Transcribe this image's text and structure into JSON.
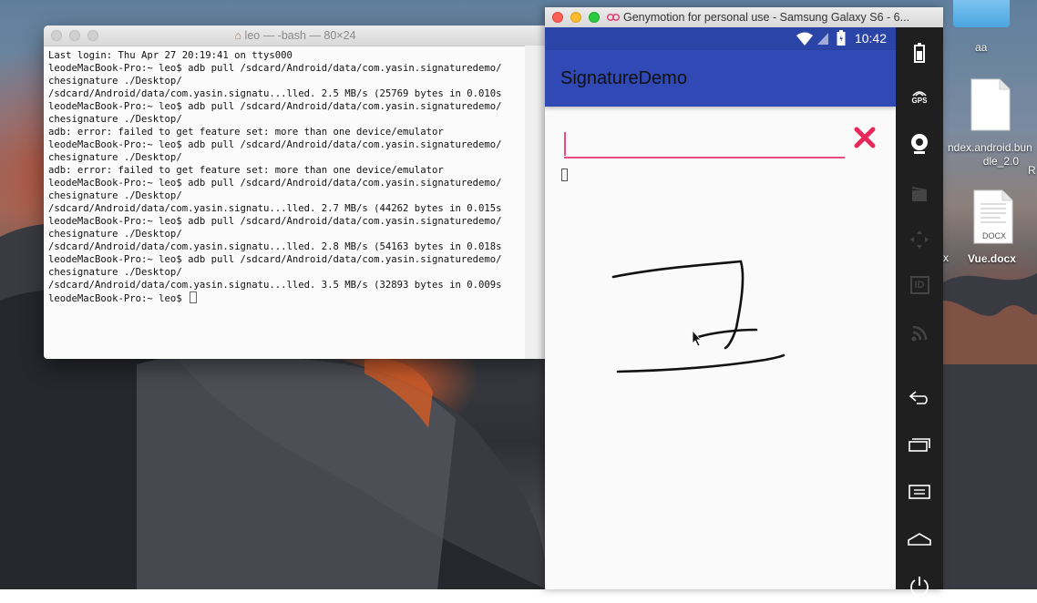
{
  "desktop": {
    "icons": [
      {
        "label": "aa"
      },
      {
        "label": "ndex.android.bun\ndle_2.0"
      },
      {
        "label": "Vue.docx",
        "badge": "DOCX"
      },
      {
        "label": "R"
      },
      {
        "label": "x"
      }
    ]
  },
  "terminal": {
    "title": "leo — -bash — 80×24",
    "title_icon": "home-icon",
    "lines": [
      "Last login: Thu Apr 27 20:19:41 on ttys000",
      "leodeMacBook-Pro:~ leo$ adb pull /sdcard/Android/data/com.yasin.signaturedemo/",
      "chesignature ./Desktop/",
      "/sdcard/Android/data/com.yasin.signatu...lled. 2.5 MB/s (25769 bytes in 0.010s",
      "leodeMacBook-Pro:~ leo$ adb pull /sdcard/Android/data/com.yasin.signaturedemo/",
      "chesignature ./Desktop/",
      "adb: error: failed to get feature set: more than one device/emulator",
      "leodeMacBook-Pro:~ leo$ adb pull /sdcard/Android/data/com.yasin.signaturedemo/",
      "chesignature ./Desktop/",
      "adb: error: failed to get feature set: more than one device/emulator",
      "leodeMacBook-Pro:~ leo$ adb pull /sdcard/Android/data/com.yasin.signaturedemo/",
      "chesignature ./Desktop/",
      "/sdcard/Android/data/com.yasin.signatu...lled. 2.7 MB/s (44262 bytes in 0.015s",
      "leodeMacBook-Pro:~ leo$ adb pull /sdcard/Android/data/com.yasin.signaturedemo/",
      "chesignature ./Desktop/",
      "/sdcard/Android/data/com.yasin.signatu...lled. 2.8 MB/s (54163 bytes in 0.018s",
      "leodeMacBook-Pro:~ leo$ adb pull /sdcard/Android/data/com.yasin.signaturedemo/",
      "chesignature ./Desktop/",
      "/sdcard/Android/data/com.yasin.signatu...lled. 3.5 MB/s (32893 bytes in 0.009s",
      "leodeMacBook-Pro:~ leo$ "
    ]
  },
  "genymotion": {
    "title": "Genymotion for personal use - Samsung Galaxy S6 - 6...",
    "status_time": "10:42",
    "app_title": "SignatureDemo",
    "input_value": "",
    "colors": {
      "primary": "#3049b4",
      "primary_dark": "#2b44a8",
      "accent": "#e84b7d",
      "clear": "#e8275a"
    },
    "sidebar": [
      {
        "name": "battery-icon"
      },
      {
        "name": "gps-icon",
        "label": "GPS"
      },
      {
        "name": "webcam-icon"
      },
      {
        "name": "media-icon"
      },
      {
        "name": "dpad-icon"
      },
      {
        "name": "identifiers-icon",
        "label": "ID"
      },
      {
        "name": "network-icon"
      },
      {
        "name": "back-icon"
      },
      {
        "name": "recent-apps-icon"
      },
      {
        "name": "menu-icon"
      },
      {
        "name": "home-icon"
      },
      {
        "name": "power-icon"
      }
    ]
  }
}
